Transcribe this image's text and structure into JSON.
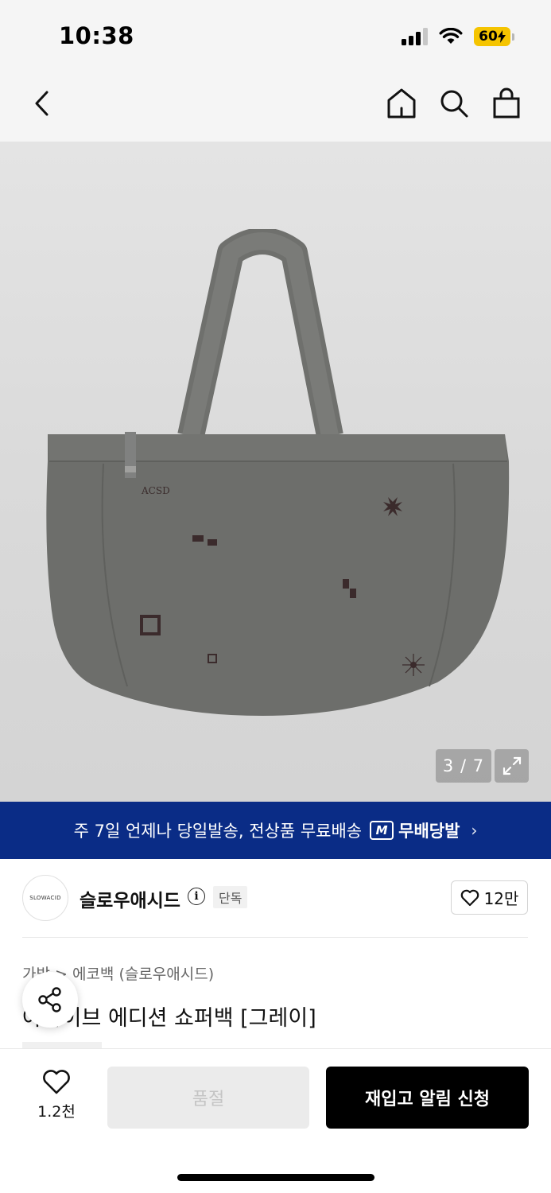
{
  "status_bar": {
    "time": "10:38",
    "battery_level": "60",
    "battery_color": "#f5c400"
  },
  "nav": {
    "back_icon": "chevron-left-icon",
    "home_icon": "home-icon",
    "search_icon": "search-icon",
    "cart_icon": "shopping-bag-icon"
  },
  "gallery": {
    "counter": "3 / 7",
    "expand_icon": "expand-icon",
    "bag_print_text": "ACSD"
  },
  "banner": {
    "text": "주 7일 언제나 당일발송, 전상품 무료배송",
    "badge_letter": "M",
    "badge_label": "무배당발",
    "background": "#0a2c86"
  },
  "brand": {
    "logo_text": "SLOWACID",
    "name": "슬로우애시드",
    "exclusive": "단독",
    "likes": "12만"
  },
  "product": {
    "breadcrumb": "가방  >  에코백 (슬로우애시드)",
    "title": "아카이브 에디션 쇼퍼백 [그레이]"
  },
  "bottom_bar": {
    "wishlist_count": "1.2천",
    "soldout_label": "품절",
    "restock_label": "재입고 알림 신청"
  }
}
